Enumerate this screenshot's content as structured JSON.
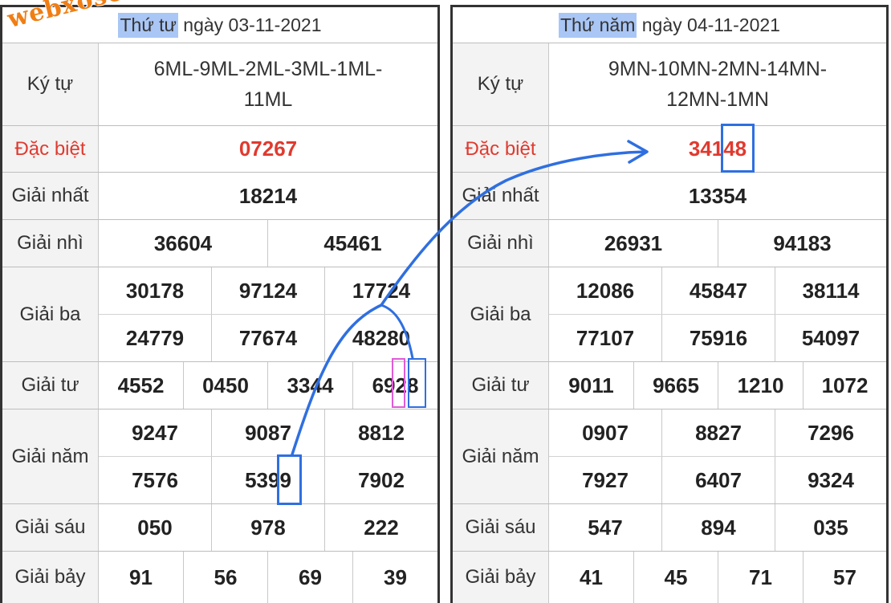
{
  "watermark": "webxoso.net",
  "labels": {
    "ky_tu": "Ký tự",
    "dac_biet": "Đặc biệt",
    "nhat": "Giải nhất",
    "nhi": "Giải nhì",
    "ba": "Giải ba",
    "tu": "Giải tư",
    "nam": "Giải năm",
    "sau": "Giải sáu",
    "bay": "Giải bảy"
  },
  "left": {
    "day": "Thứ tư",
    "date_text": "ngày 03-11-2021",
    "kytu_line1": "6ML-9ML-2ML-3ML-1ML-",
    "kytu_line2": "11ML",
    "dac_biet": "07267",
    "nhat": "18214",
    "nhi": [
      "36604",
      "45461"
    ],
    "ba": [
      "30178",
      "97124",
      "17724",
      "24779",
      "77674",
      "48280"
    ],
    "tu": [
      "4552",
      "0450",
      "3344",
      "6928"
    ],
    "nam": [
      "9247",
      "9087",
      "8812",
      "7576",
      "5399",
      "7902"
    ],
    "sau": [
      "050",
      "978",
      "222"
    ],
    "bay": [
      "91",
      "56",
      "69",
      "39"
    ]
  },
  "right": {
    "day": "Thứ năm",
    "date_text": "ngày 04-11-2021",
    "kytu_line1": "9MN-10MN-2MN-14MN-",
    "kytu_line2": "12MN-1MN",
    "dac_biet": "34148",
    "nhat": "13354",
    "nhi": [
      "26931",
      "94183"
    ],
    "ba": [
      "12086",
      "45847",
      "38114",
      "77107",
      "75916",
      "54097"
    ],
    "tu": [
      "9011",
      "9665",
      "1210",
      "1072"
    ],
    "nam": [
      "0907",
      "8827",
      "7296",
      "7927",
      "6407",
      "9324"
    ],
    "sau": [
      "547",
      "894",
      "035"
    ],
    "bay": [
      "41",
      "45",
      "71",
      "57"
    ]
  },
  "colors": {
    "red": "#e03a2f",
    "arrow_blue": "#2f6fe0",
    "highlight_pink": "#e05cd6",
    "day_highlight": "#a9c6f5",
    "watermark_orange": "#f07e14"
  }
}
